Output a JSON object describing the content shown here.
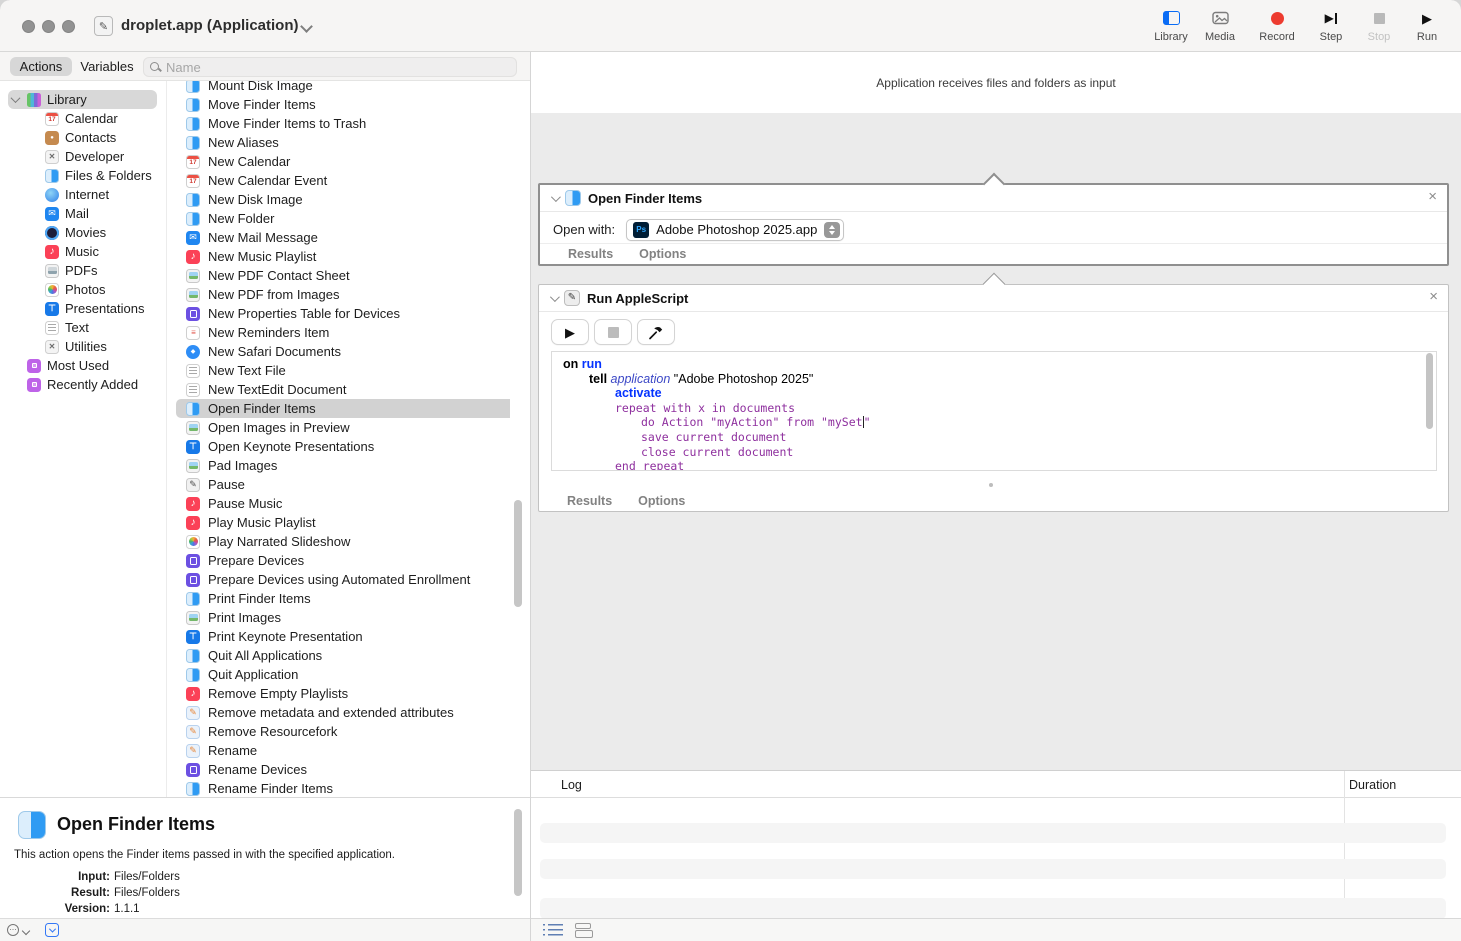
{
  "window": {
    "title": "droplet.app (Application)"
  },
  "toolbar": {
    "library": {
      "label": "Library"
    },
    "media": {
      "label": "Media"
    },
    "record": {
      "label": "Record"
    },
    "step": {
      "label": "Step"
    },
    "stop": {
      "label": "Stop"
    },
    "run": {
      "label": "Run"
    },
    "accent_blue": "#0a6cf5",
    "record_red": "#ed3b2f"
  },
  "filter": {
    "tabs": [
      {
        "label": "Actions",
        "selected": true
      },
      {
        "label": "Variables",
        "selected": false
      }
    ],
    "search_placeholder": "Name"
  },
  "sidebar": {
    "items": [
      {
        "label": "Library",
        "icon": "library",
        "pad": 12,
        "cls": "lib",
        "selected": true
      },
      {
        "label": "Calendar",
        "icon": "calendar",
        "glyph": "17",
        "pad": 45
      },
      {
        "label": "Contacts",
        "icon": "contacts",
        "glyph": "●",
        "pad": 45
      },
      {
        "label": "Developer",
        "icon": "tools",
        "glyph": "✕",
        "pad": 45
      },
      {
        "label": "Files & Folders",
        "icon": "finder",
        "pad": 45
      },
      {
        "label": "Internet",
        "icon": "globe",
        "pad": 45
      },
      {
        "label": "Mail",
        "icon": "mail",
        "glyph": "✉",
        "pad": 45
      },
      {
        "label": "Movies",
        "icon": "movies",
        "pad": 45
      },
      {
        "label": "Music",
        "icon": "music",
        "glyph": "♪",
        "pad": 45
      },
      {
        "label": "PDFs",
        "icon": "pdf",
        "boxed": true,
        "pad": 45
      },
      {
        "label": "Photos",
        "icon": "photos",
        "boxed": true,
        "pad": 45
      },
      {
        "label": "Presentations",
        "icon": "keynote",
        "glyph": "⊤",
        "pad": 45
      },
      {
        "label": "Text",
        "icon": "textfile",
        "boxed": true,
        "pad": 45
      },
      {
        "label": "Utilities",
        "icon": "tools",
        "glyph": "✕",
        "pad": 45
      },
      {
        "label": "Most Used",
        "icon": "smartfolder",
        "boxed": true,
        "pad": 27
      },
      {
        "label": "Recently Added",
        "icon": "smartfolder",
        "boxed": true,
        "pad": 27
      }
    ]
  },
  "actions_list": {
    "items": [
      {
        "label": "Mount Disk Image",
        "icon": "finder"
      },
      {
        "label": "Move Finder Items",
        "icon": "finder"
      },
      {
        "label": "Move Finder Items to Trash",
        "icon": "finder"
      },
      {
        "label": "New Aliases",
        "icon": "finder"
      },
      {
        "label": "New Calendar",
        "icon": "calendar",
        "glyph": "17"
      },
      {
        "label": "New Calendar Event",
        "icon": "calendar",
        "glyph": "17"
      },
      {
        "label": "New Disk Image",
        "icon": "finder"
      },
      {
        "label": "New Folder",
        "icon": "finder"
      },
      {
        "label": "New Mail Message",
        "icon": "mail",
        "glyph": "✉"
      },
      {
        "label": "New Music Playlist",
        "icon": "music",
        "glyph": "♪"
      },
      {
        "label": "New PDF Contact Sheet",
        "icon": "preview",
        "boxed": true
      },
      {
        "label": "New PDF from Images",
        "icon": "preview",
        "boxed": true
      },
      {
        "label": "New Properties Table for Devices",
        "icon": "device",
        "boxed": true
      },
      {
        "label": "New Reminders Item",
        "icon": "reminders",
        "glyph": "≡"
      },
      {
        "label": "New Safari Documents",
        "icon": "safari",
        "glyph": "◆"
      },
      {
        "label": "New Text File",
        "icon": "textfile",
        "boxed": true
      },
      {
        "label": "New TextEdit Document",
        "icon": "textfile",
        "boxed": true
      },
      {
        "label": "Open Finder Items",
        "icon": "finder",
        "selected": true
      },
      {
        "label": "Open Images in Preview",
        "icon": "preview",
        "boxed": true
      },
      {
        "label": "Open Keynote Presentations",
        "icon": "keynote",
        "glyph": "⊤"
      },
      {
        "label": "Pad Images",
        "icon": "preview",
        "boxed": true
      },
      {
        "label": "Pause",
        "icon": "wand",
        "glyph": "✎"
      },
      {
        "label": "Pause Music",
        "icon": "music",
        "glyph": "♪"
      },
      {
        "label": "Play Music Playlist",
        "icon": "music",
        "glyph": "♪"
      },
      {
        "label": "Play Narrated Slideshow",
        "icon": "photos",
        "boxed": true
      },
      {
        "label": "Prepare Devices",
        "icon": "device",
        "boxed": true
      },
      {
        "label": "Prepare Devices using Automated Enrollment",
        "icon": "device",
        "boxed": true
      },
      {
        "label": "Print Finder Items",
        "icon": "finder"
      },
      {
        "label": "Print Images",
        "icon": "preview",
        "boxed": true
      },
      {
        "label": "Print Keynote Presentation",
        "icon": "keynote",
        "glyph": "⊤"
      },
      {
        "label": "Quit All Applications",
        "icon": "finder"
      },
      {
        "label": "Quit Application",
        "icon": "finder"
      },
      {
        "label": "Remove Empty Playlists",
        "icon": "music",
        "glyph": "♪"
      },
      {
        "label": "Remove metadata and extended attributes",
        "icon": "fileedit",
        "glyph": "✎"
      },
      {
        "label": "Remove Resourcefork",
        "icon": "fileedit",
        "glyph": "✎"
      },
      {
        "label": "Rename",
        "icon": "fileedit",
        "glyph": "✎"
      },
      {
        "label": "Rename Devices",
        "icon": "device",
        "boxed": true
      },
      {
        "label": "Rename Finder Items",
        "icon": "finder"
      }
    ]
  },
  "workflow": {
    "input_caption": "Application receives files and folders as input",
    "block1": {
      "title": "Open Finder Items",
      "open_with_label": "Open with:",
      "open_with_value": "Adobe Photoshop 2025.app",
      "ps_badge": "Ps",
      "results_label": "Results",
      "options_label": "Options"
    },
    "block2": {
      "title": "Run AppleScript",
      "results_label": "Results",
      "options_label": "Options"
    }
  },
  "applescript": {
    "lines": [
      {
        "ind": 0,
        "segs": [
          {
            "t": "on ",
            "s": "b"
          },
          {
            "t": "run",
            "s": "cmd"
          }
        ]
      },
      {
        "ind": 26,
        "segs": [
          {
            "t": "tell ",
            "s": "b"
          },
          {
            "t": "application ",
            "s": "app"
          },
          {
            "t": "\"Adobe Photoshop 2025\"",
            "s": "str"
          }
        ]
      },
      {
        "ind": 52,
        "segs": [
          {
            "t": "activate",
            "s": "cmd"
          }
        ]
      },
      {
        "ind": 52,
        "segs": [
          {
            "t": "repeat with x in documents",
            "s": "raw"
          }
        ]
      },
      {
        "ind": 78,
        "segs": [
          {
            "t": "do Action \"myAction\" from \"mySet",
            "s": "raw"
          },
          {
            "t": "",
            "s": "cursor"
          },
          {
            "t": "\"",
            "s": "raw"
          }
        ]
      },
      {
        "ind": 78,
        "segs": [
          {
            "t": "save current document",
            "s": "raw"
          }
        ]
      },
      {
        "ind": 78,
        "segs": [
          {
            "t": "close current document",
            "s": "raw"
          }
        ]
      },
      {
        "ind": 52,
        "segs": [
          {
            "t": "end repeat",
            "s": "raw"
          }
        ]
      }
    ],
    "colors": {
      "keyword_blue": "#0433ff",
      "application_blue": "#3c48c6",
      "uncompiled_purple": "#8e2f9e"
    }
  },
  "log": {
    "col_log": "Log",
    "col_duration": "Duration"
  },
  "description": {
    "title": "Open Finder Items",
    "text": "This action opens the Finder items passed in with the specified application.",
    "fields": [
      {
        "label": "Input:",
        "value": "Files/Folders"
      },
      {
        "label": "Result:",
        "value": "Files/Folders"
      },
      {
        "label": "Version:",
        "value": "1.1.1"
      }
    ]
  }
}
